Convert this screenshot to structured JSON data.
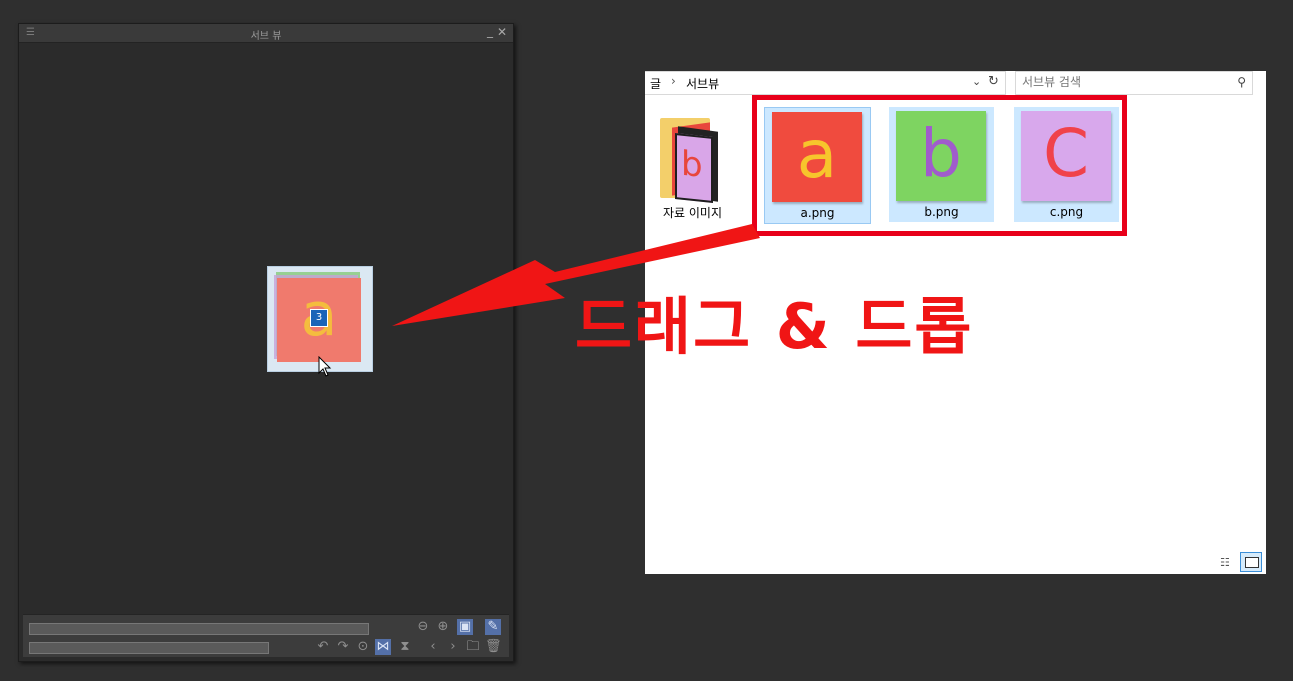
{
  "subview": {
    "menu_icon": "hamburger-icon",
    "title": "서브 뷰",
    "minimize": "_",
    "close": "✕",
    "drag_count": "3",
    "drag_letter": "a"
  },
  "explorer": {
    "address_root": "글",
    "address_separator": "›",
    "address_folder": "서브뷰",
    "search_placeholder": "서브뷰 검색",
    "folder": {
      "label": "자료 이미지",
      "thumb_letter": "b"
    },
    "files": [
      {
        "name": "a.png",
        "letter": "a",
        "bg": "#f04b3e",
        "fg": "#f7c52c"
      },
      {
        "name": "b.png",
        "letter": "b",
        "bg": "#7ed461",
        "fg": "#a05ccc"
      },
      {
        "name": "c.png",
        "letter": "C",
        "bg": "#d8a8ec",
        "fg": "#f0424a"
      }
    ]
  },
  "annotation": {
    "caption": "드래그 & 드롭",
    "color": "#f01515"
  }
}
